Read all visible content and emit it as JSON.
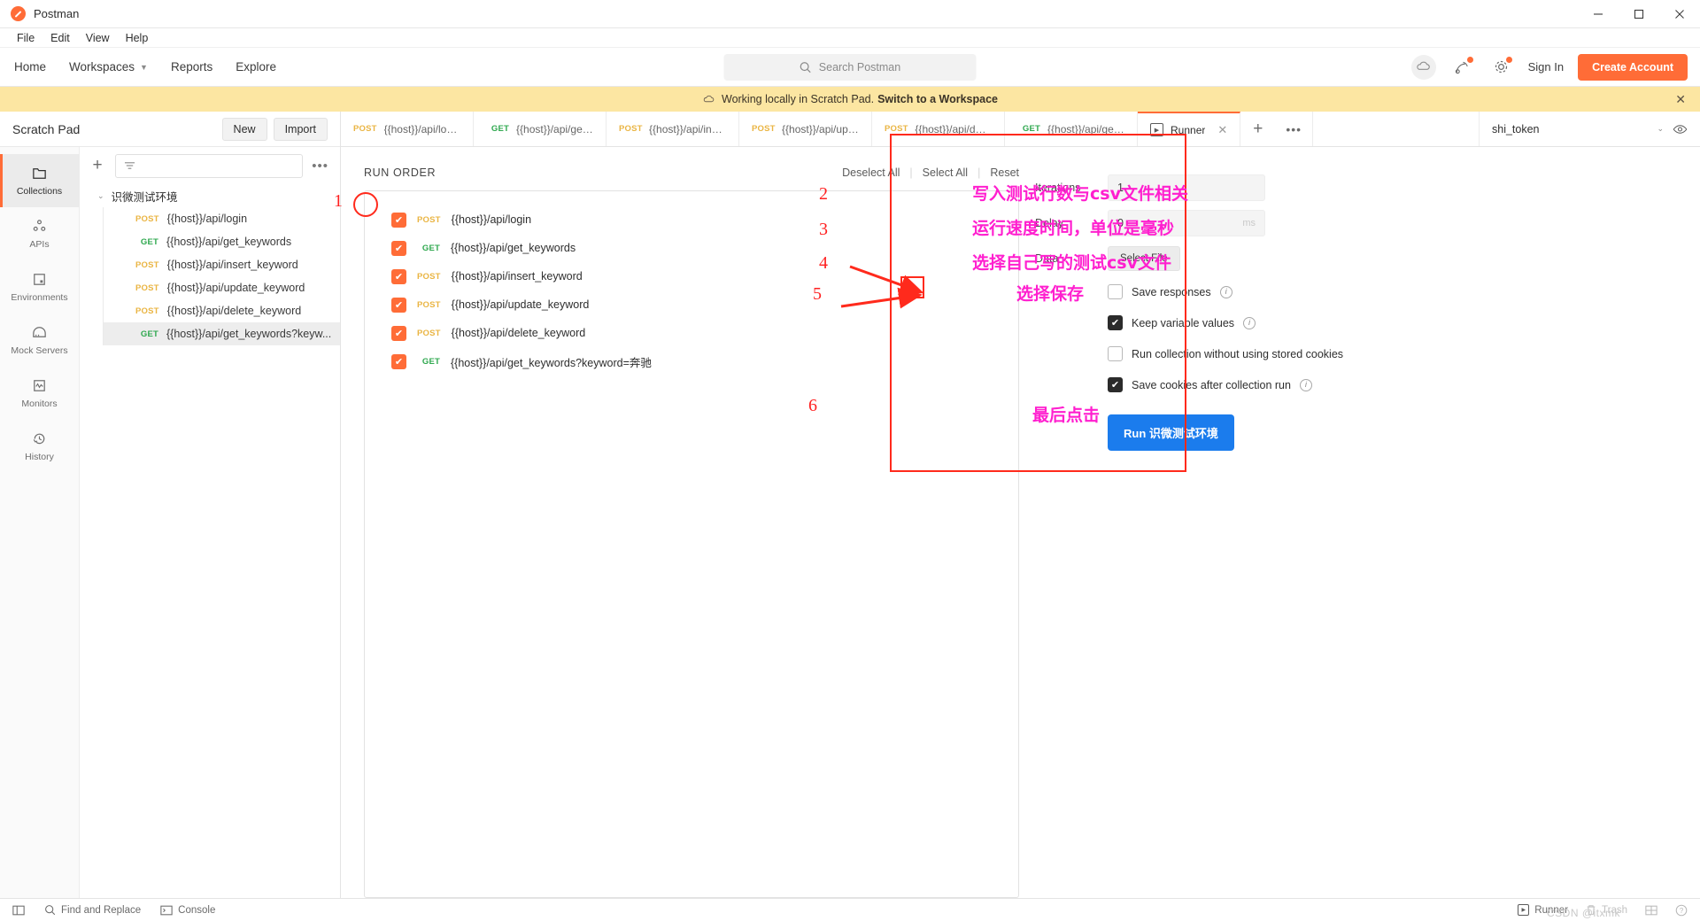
{
  "window": {
    "app_title": "Postman",
    "minimize": "—",
    "maximize": "□",
    "close": "✕"
  },
  "menubar": {
    "items": [
      "File",
      "Edit",
      "View",
      "Help"
    ]
  },
  "navbar": {
    "links": [
      {
        "label": "Home",
        "has_chevron": false
      },
      {
        "label": "Workspaces",
        "has_chevron": true
      },
      {
        "label": "Reports",
        "has_chevron": false
      },
      {
        "label": "Explore",
        "has_chevron": false
      }
    ],
    "search_placeholder": "Search Postman",
    "sign_in": "Sign In",
    "create_account": "Create Account",
    "icons": [
      "cloud-sync-icon",
      "satellite-icon",
      "gear-icon"
    ]
  },
  "banner": {
    "text": "Working locally in Scratch Pad.",
    "link": "Switch to a Workspace",
    "close": "✕"
  },
  "sidebar": {
    "title": "Scratch Pad",
    "new_label": "New",
    "import_label": "Import",
    "rail_items": [
      {
        "label": "Collections",
        "icon": "collections-icon",
        "active": true
      },
      {
        "label": "APIs",
        "icon": "apis-icon",
        "active": false
      },
      {
        "label": "Environments",
        "icon": "environments-icon",
        "active": false
      },
      {
        "label": "Mock Servers",
        "icon": "mock-servers-icon",
        "active": false
      },
      {
        "label": "Monitors",
        "icon": "monitors-icon",
        "active": false
      },
      {
        "label": "History",
        "icon": "history-icon",
        "active": false
      }
    ],
    "filter_placeholder": "",
    "collection_name": "识微测试环境",
    "requests": [
      {
        "method": "POST",
        "name": "{{host}}/api/login",
        "selected": false
      },
      {
        "method": "GET",
        "name": "{{host}}/api/get_keywords",
        "selected": false
      },
      {
        "method": "POST",
        "name": "{{host}}/api/insert_keyword",
        "selected": false
      },
      {
        "method": "POST",
        "name": "{{host}}/api/update_keyword",
        "selected": false
      },
      {
        "method": "POST",
        "name": "{{host}}/api/delete_keyword",
        "selected": false
      },
      {
        "method": "GET",
        "name": "{{host}}/api/get_keywords?keyw...",
        "selected": true
      }
    ]
  },
  "tabs": {
    "items": [
      {
        "method": "POST",
        "name": "{{host}}/api/login",
        "active": false
      },
      {
        "method": "GET",
        "name": "{{host}}/api/get_k...",
        "active": false
      },
      {
        "method": "POST",
        "name": "{{host}}/api/inse...",
        "active": false
      },
      {
        "method": "POST",
        "name": "{{host}}/api/upd...",
        "active": false
      },
      {
        "method": "POST",
        "name": "{{host}}/api/del...",
        "active": false
      },
      {
        "method": "GET",
        "name": "{{host}}/api/get_k...",
        "active": false
      }
    ],
    "runner_tab": {
      "label": "Runner",
      "active": true,
      "close": "✕"
    },
    "add": "+",
    "more": "•••",
    "environment": "shi_token",
    "env_chevron": "⌄"
  },
  "runner": {
    "run_order_title": "RUN ORDER",
    "deselect_all": "Deselect All",
    "select_all": "Select All",
    "reset": "Reset",
    "items": [
      {
        "method": "POST",
        "name": "{{host}}/api/login",
        "checked": true
      },
      {
        "method": "GET",
        "name": "{{host}}/api/get_keywords",
        "checked": true
      },
      {
        "method": "POST",
        "name": "{{host}}/api/insert_keyword",
        "checked": true
      },
      {
        "method": "POST",
        "name": "{{host}}/api/update_keyword",
        "checked": true
      },
      {
        "method": "POST",
        "name": "{{host}}/api/delete_keyword",
        "checked": true
      },
      {
        "method": "GET",
        "name": "{{host}}/api/get_keywords?keyword=奔驰",
        "checked": true
      }
    ],
    "settings": {
      "iterations_label": "Iterations",
      "iterations_value": "1",
      "delay_label": "Delay",
      "delay_value": "0",
      "delay_unit": "ms",
      "data_label": "Data",
      "select_file_label": "Select File",
      "options": [
        {
          "label": "Save responses",
          "checked": false,
          "info": true
        },
        {
          "label": "Keep variable values",
          "checked": true,
          "info": true
        },
        {
          "label": "Run collection without using stored cookies",
          "checked": false,
          "info": false
        },
        {
          "label": "Save cookies after collection run",
          "checked": true,
          "info": true
        }
      ],
      "run_button": "Run 识微测试环境"
    }
  },
  "annotations": {
    "numbers": [
      "1",
      "2",
      "3",
      "4",
      "5",
      "6"
    ],
    "notes": [
      "写入测试行数与csv文件相关",
      "运行速度时间，单位是毫秒",
      "选择自己写的测试csv文件",
      "选择保存",
      "最后点击"
    ],
    "accent_red": "#ff2a1c",
    "accent_magenta": "#ff1fcf"
  },
  "footer": {
    "layout_label": "",
    "find_replace": "Find and Replace",
    "console": "Console",
    "runner": "Runner",
    "trash": "Trash",
    "watermark": "CSDN @itxmk"
  },
  "colors": {
    "brand_orange": "#ff6c37",
    "method_post": "#eab543",
    "method_get": "#2fa84f",
    "run_blue": "#1b7ced",
    "banner_yellow": "#fce6a2"
  }
}
